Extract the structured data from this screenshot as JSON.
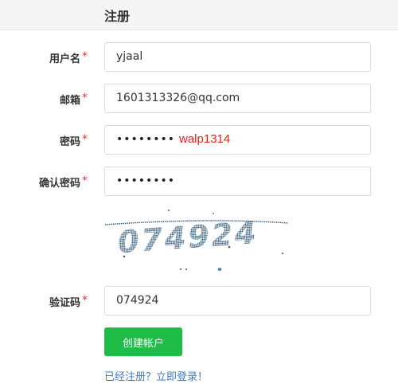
{
  "header": {
    "title": "注册"
  },
  "form": {
    "username": {
      "label": "用户名",
      "required_mark": "*",
      "value": "yjaal"
    },
    "email": {
      "label": "邮箱",
      "required_mark": "*",
      "value": "1601313326@qq.com"
    },
    "password": {
      "label": "密码",
      "required_mark": "*",
      "masked_value": "••••••••",
      "annotation": "walp1314"
    },
    "confirm_password": {
      "label": "确认密码",
      "required_mark": "*",
      "masked_value": "••••••••"
    },
    "captcha_image": {
      "text": "074924"
    },
    "captcha": {
      "label": "验证码",
      "required_mark": "*",
      "value": "074924"
    },
    "submit_label": "创建帐户",
    "login_link": "已经注册？立即登录！"
  },
  "colors": {
    "accent_button": "#1fbc48",
    "link": "#3c7cbd",
    "required": "#e4393c",
    "captcha_ink": "#2e5a78"
  }
}
